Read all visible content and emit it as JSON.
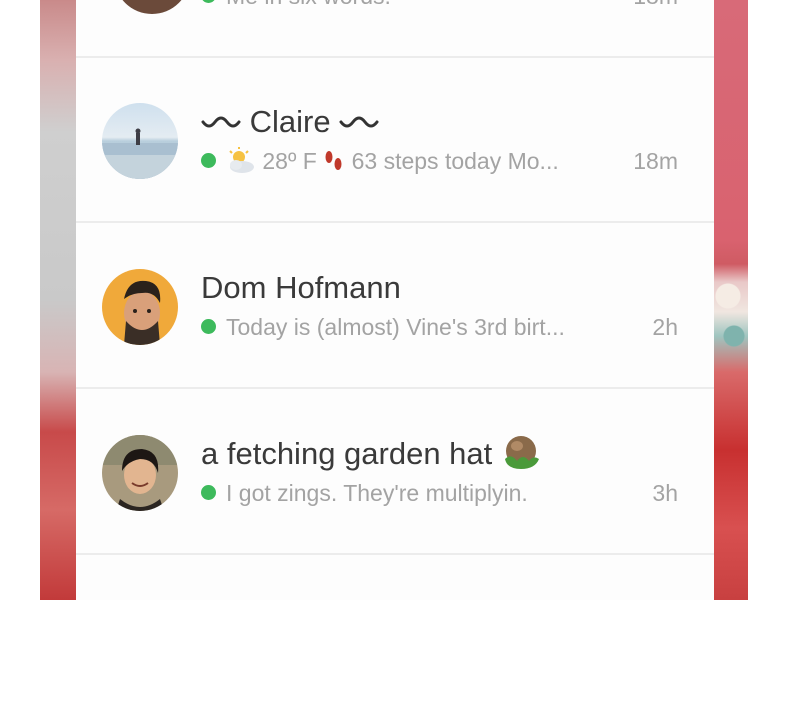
{
  "conversations": [
    {
      "name": "",
      "preview": "Me in six words.",
      "time": "18m",
      "online": true
    },
    {
      "name": "Claire",
      "preview_temp": "28º F",
      "preview_text": "63 steps today Mo...",
      "time": "18m",
      "online": true,
      "avatar": "beach-photo"
    },
    {
      "name": "Dom Hofmann",
      "preview": "Today is (almost) Vine's 3rd birt...",
      "time": "2h",
      "online": true,
      "avatar": "man-portrait"
    },
    {
      "name": "a fetching garden hat",
      "preview": "I got zings. They're multiplyin.",
      "time": "3h",
      "online": true,
      "avatar": "woman-portrait"
    }
  ],
  "icons": {
    "status": "online-dot-icon",
    "weather": "sun-behind-cloud-icon",
    "steps": "footprints-icon",
    "hat": "garden-hat-icon",
    "wave": "wave-icon"
  },
  "colors": {
    "online": "#3dba5c",
    "name_text": "#3a3a3a",
    "secondary_text": "#a3a3a3",
    "divider": "#ececec"
  }
}
